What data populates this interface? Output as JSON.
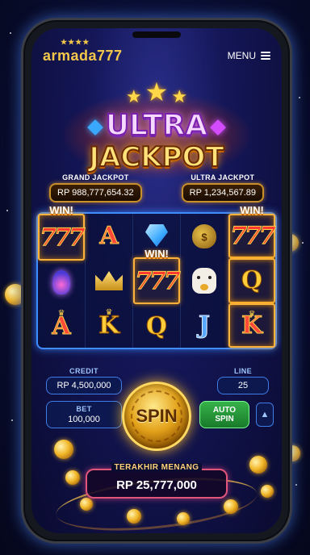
{
  "app": {
    "logo": "armada777",
    "menu_label": "MENU"
  },
  "title": {
    "line1": "ULTRA",
    "line2": "JACKPOT"
  },
  "jackpots": [
    {
      "label": "GRAND JACKPOT",
      "value": "RP 988,777,654.32"
    },
    {
      "label": "ULTRA JACKPOT",
      "value": "RP 1,234,567.89"
    }
  ],
  "reels": {
    "win_tag": "WIN!",
    "columns": [
      [
        "777",
        "lamp",
        "A"
      ],
      [
        "A",
        "crown",
        "K"
      ],
      [
        "diamond",
        "777",
        "Q"
      ],
      [
        "money-bag",
        "lucky-cat",
        "J"
      ],
      [
        "777",
        "Q",
        "K"
      ]
    ]
  },
  "credit": {
    "label": "CREDIT",
    "value": "RP 4,500,000"
  },
  "line": {
    "label": "LINE",
    "value": "25"
  },
  "bet": {
    "label": "BET",
    "value": "100,000"
  },
  "spin": {
    "label": "SPIN"
  },
  "auto_spin": {
    "line1": "AUTO",
    "line2": "SPIN"
  },
  "last_win": {
    "label": "TERAKHIR MENANG",
    "value": "RP 25,777,000"
  },
  "colors": {
    "accent_gold": "#f3c84a",
    "reel_border": "#3f8cff",
    "win_border": "#ffb23a",
    "auto_green": "#36b24a"
  }
}
